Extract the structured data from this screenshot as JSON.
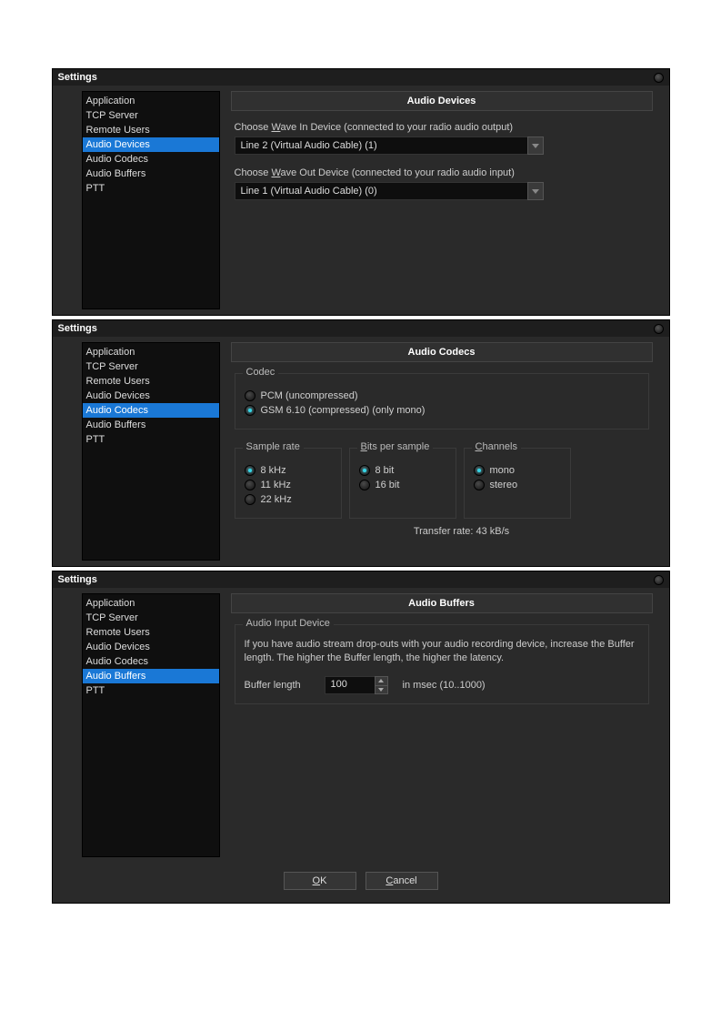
{
  "panels": {
    "devices": {
      "title": "Settings",
      "sidebar": {
        "items": [
          "Application",
          "TCP Server",
          "Remote Users",
          "Audio Devices",
          "Audio Codecs",
          "Audio Buffers",
          "PTT"
        ],
        "selected": "Audio Devices"
      },
      "sectionTitle": "Audio Devices",
      "waveIn": {
        "prefix": "Choose ",
        "accel": "W",
        "rest": "ave In Device (connected to your radio audio output)",
        "value": "Line 2 (Virtual Audio Cable) (1)"
      },
      "waveOut": {
        "prefix": "Choose ",
        "accel": "W",
        "rest": "ave Out Device (connected to your radio audio input)",
        "value": "Line 1 (Virtual Audio Cable) (0)"
      }
    },
    "codecs": {
      "title": "Settings",
      "sidebar": {
        "items": [
          "Application",
          "TCP Server",
          "Remote Users",
          "Audio Devices",
          "Audio Codecs",
          "Audio Buffers",
          "PTT"
        ],
        "selected": "Audio Codecs"
      },
      "sectionTitle": "Audio Codecs",
      "codecGroup": {
        "label": "Codec",
        "options": [
          {
            "label": "PCM (uncompressed)",
            "checked": false
          },
          {
            "label": "GSM 6.10 (compressed) (only mono)",
            "checked": true
          }
        ]
      },
      "sampleRate": {
        "label": "Sample rate",
        "options": [
          {
            "label": "8 kHz",
            "checked": true
          },
          {
            "label": "11 kHz",
            "checked": false
          },
          {
            "label": "22 kHz",
            "checked": false
          }
        ]
      },
      "bitsPerSample": {
        "label": "B",
        "labelRest": "its per sample",
        "options": [
          {
            "label": "8 bit",
            "checked": true
          },
          {
            "label": "16 bit",
            "checked": false
          }
        ]
      },
      "channels": {
        "label": "C",
        "labelRest": "hannels",
        "options": [
          {
            "label": "mono",
            "checked": true
          },
          {
            "label": "stereo",
            "checked": false
          }
        ]
      },
      "transferRate": "Transfer rate: 43 kB/s"
    },
    "buffers": {
      "title": "Settings",
      "sidebar": {
        "items": [
          "Application",
          "TCP Server",
          "Remote Users",
          "Audio Devices",
          "Audio Codecs",
          "Audio Buffers",
          "PTT"
        ],
        "selected": "Audio Buffers"
      },
      "sectionTitle": "Audio Buffers",
      "group": {
        "label": "Audio Input Device",
        "help": "If you have audio stream drop-outs with your audio recording device, increase the Buffer length. The higher the Buffer length, the higher the latency.",
        "fieldLabel": "Buffer length",
        "value": "100",
        "unit": "in msec (10..1000)"
      },
      "buttons": {
        "ok": "OK",
        "cancel": "Cancel",
        "okAccel": "O",
        "okRest": "K",
        "cancelAccel": "C",
        "cancelRest": "ancel"
      }
    }
  }
}
